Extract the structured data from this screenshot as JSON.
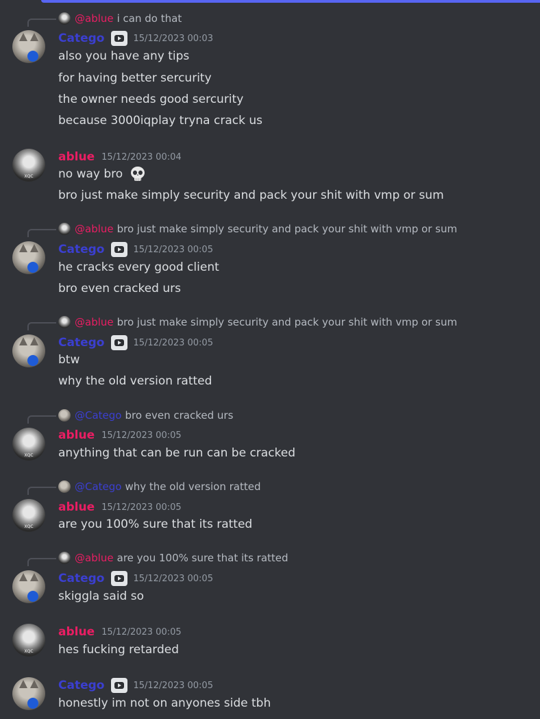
{
  "colors": {
    "background": "#313338",
    "catego_name": "#3b3fd0",
    "ablue_name": "#e91e63",
    "timestamp": "#949ba4",
    "message_text": "#dbdee1",
    "accent_bar": "#5865f2"
  },
  "messages": [
    {
      "reply": {
        "mention": "@ablue",
        "text": "i can do that"
      },
      "author": "Catego",
      "has_badge": true,
      "badge_icon": "youtube-icon",
      "time": "15/12/2023 00:03",
      "lines": [
        "also you have any tips",
        "for having better sercurity",
        "the owner needs good sercurity",
        "because 3000iqplay tryna crack us"
      ]
    },
    {
      "author": "ablue",
      "time": "15/12/2023 00:04",
      "lines": [
        "no way bro",
        "bro just make simply security and pack your shit with vmp or sum"
      ],
      "emoji": "skull-emoji"
    },
    {
      "reply": {
        "mention": "@ablue",
        "text": "bro just make simply security and pack your shit with vmp or sum"
      },
      "author": "Catego",
      "has_badge": true,
      "time": "15/12/2023 00:05",
      "lines": [
        "he cracks every good client",
        "bro even cracked urs"
      ]
    },
    {
      "reply": {
        "mention": "@ablue",
        "text": "bro just make simply security and pack your shit with vmp or sum"
      },
      "author": "Catego",
      "has_badge": true,
      "time": "15/12/2023 00:05",
      "lines": [
        "btw",
        "why the old version ratted"
      ]
    },
    {
      "reply": {
        "mention": "@Catego",
        "text": "bro even cracked urs"
      },
      "author": "ablue",
      "time": "15/12/2023 00:05",
      "lines": [
        "anything that can be run can be cracked"
      ]
    },
    {
      "reply": {
        "mention": "@Catego",
        "text": "why the old version ratted"
      },
      "author": "ablue",
      "time": "15/12/2023 00:05",
      "lines": [
        "are you 100% sure that its ratted"
      ]
    },
    {
      "reply": {
        "mention": "@ablue",
        "text": "are you 100% sure that its ratted"
      },
      "author": "Catego",
      "has_badge": true,
      "time": "15/12/2023 00:05",
      "lines": [
        "skiggla said so"
      ]
    },
    {
      "author": "ablue",
      "time": "15/12/2023 00:05",
      "lines": [
        "hes fucking retarded"
      ]
    },
    {
      "author": "Catego",
      "has_badge": true,
      "time": "15/12/2023 00:05",
      "lines": [
        "honestly im not on anyones side tbh"
      ]
    }
  ],
  "avatar_tag_text": "XQC"
}
